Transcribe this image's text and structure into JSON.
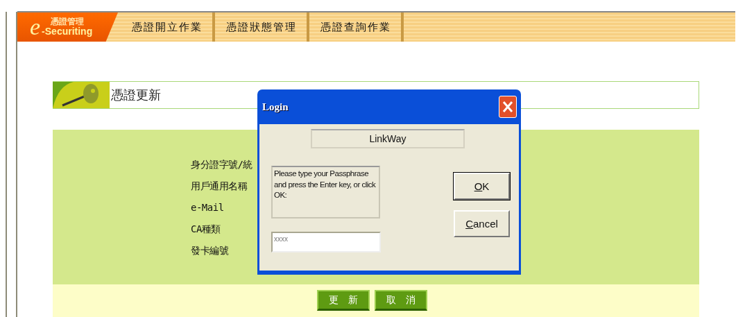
{
  "logo": {
    "letter": "e",
    "title": "憑證管理",
    "subtitle": "-Securiting"
  },
  "nav": {
    "tabs": [
      {
        "label": "憑證開立作業"
      },
      {
        "label": "憑證狀態管理"
      },
      {
        "label": "憑證查詢作業"
      }
    ]
  },
  "page": {
    "title": "憑證更新",
    "fields": [
      {
        "label": "身分證字號/統"
      },
      {
        "label": "用戶通用名稱"
      },
      {
        "label": "e-Mail"
      },
      {
        "label": "CA種類"
      },
      {
        "label": "發卡編號"
      }
    ],
    "buttons": [
      {
        "label": "更　新"
      },
      {
        "label": "取　消"
      }
    ]
  },
  "dialog": {
    "title": "Login",
    "app_name": "LinkWay",
    "message": "Please type your Passphrase and press the Enter key, or click OK:",
    "passphrase": "xxxx",
    "buttons": [
      {
        "label": "OK",
        "default": true
      },
      {
        "label": "Cancel",
        "default": false
      }
    ]
  }
}
